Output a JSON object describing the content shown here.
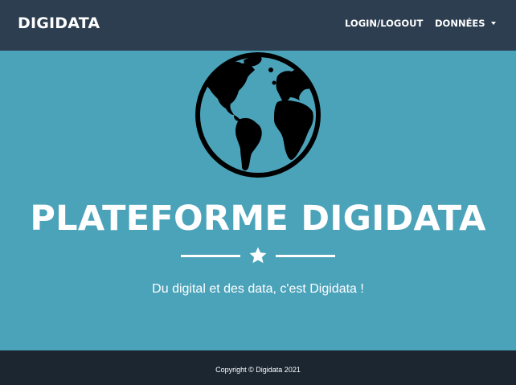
{
  "colors": {
    "navbar": "#2c3e50",
    "hero_background": "#4ba3ba",
    "footer": "#1b2631",
    "text": "#ffffff",
    "globe": "#000000"
  },
  "navbar": {
    "brand": "DIGIDATA",
    "items": [
      {
        "label": "LOGIN/LOGOUT"
      },
      {
        "label": "DONNÉES",
        "icon": "caret-down-icon"
      }
    ]
  },
  "hero": {
    "icon": "globe-americas-icon",
    "title": "PLATEFORME DIGIDATA",
    "divider_icon": "star-icon",
    "subtitle": "Du digital et des data, c'est Digidata !"
  },
  "footer": {
    "copyright": "Copyright © Digidata 2021"
  }
}
